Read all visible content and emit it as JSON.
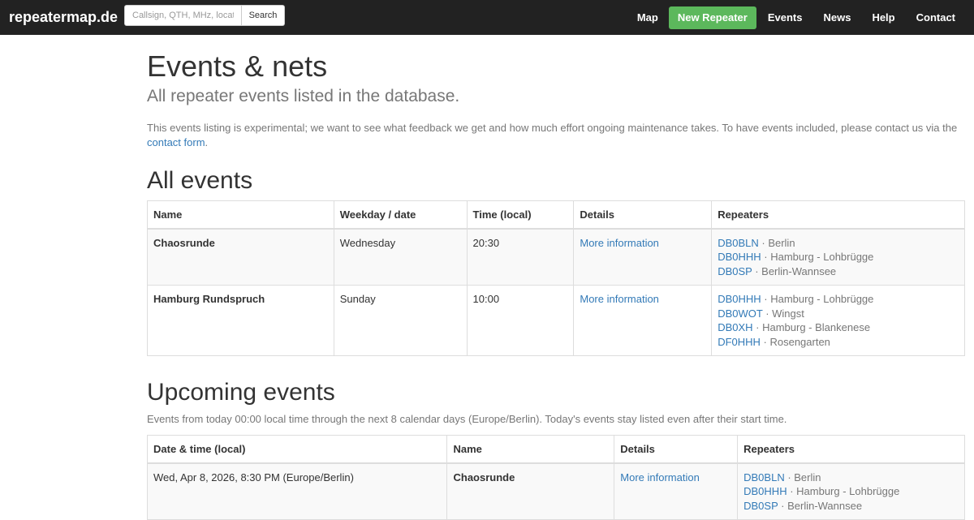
{
  "navbar": {
    "brand": "repeatermap.de",
    "search_placeholder": "Callsign, QTH, MHz, locator",
    "search_button": "Search",
    "links": {
      "map": "Map",
      "new_repeater": "New Repeater",
      "events": "Events",
      "news": "News",
      "help": "Help",
      "contact": "Contact"
    },
    "colors": {
      "bar": "#222222",
      "new_repeater_green": "#5cb85c"
    }
  },
  "page": {
    "title": "Events & nets",
    "lead": "All repeater events listed in the database.",
    "intro_text": "This events listing is experimental; we want to see what feedback we get and how much effort ongoing maintenance takes. To have events included, please contact us via the ",
    "intro_link": "contact form",
    "intro_end": "."
  },
  "all_events": {
    "heading": "All events",
    "columns": [
      "Name",
      "Weekday / date",
      "Time (local)",
      "Details",
      "Repeaters"
    ],
    "rows": [
      {
        "name": "Chaosrunde",
        "weekday": "Wednesday",
        "time": "20:30",
        "details": "More information",
        "repeaters": [
          {
            "call": "DB0BLN",
            "qth": " · Berlin"
          },
          {
            "call": "DB0HHH",
            "qth": " · Hamburg - Lohbrügge"
          },
          {
            "call": "DB0SP",
            "qth": " · Berlin-Wannsee"
          }
        ]
      },
      {
        "name": "Hamburg Rundspruch",
        "weekday": "Sunday",
        "time": "10:00",
        "details": "More information",
        "repeaters": [
          {
            "call": "DB0HHH",
            "qth": " · Hamburg - Lohbrügge"
          },
          {
            "call": "DB0WOT",
            "qth": " · Wingst"
          },
          {
            "call": "DB0XH",
            "qth": " · Hamburg - Blankenese"
          },
          {
            "call": "DF0HHH",
            "qth": " · Rosengarten"
          }
        ]
      }
    ]
  },
  "upcoming": {
    "heading": "Upcoming events",
    "subtext": "Events from today 00:00 local time through the next 8 calendar days (Europe/Berlin). Today's events stay listed even after their start time.",
    "columns": [
      "Date & time (local)",
      "Name",
      "Details",
      "Repeaters"
    ],
    "rows": [
      {
        "datetime": "Wed, Apr 8, 2026, 8:30 PM (Europe/Berlin)",
        "name": "Chaosrunde",
        "details": "More information",
        "repeaters": [
          {
            "call": "DB0BLN",
            "qth": " · Berlin"
          },
          {
            "call": "DB0HHH",
            "qth": " · Hamburg - Lohbrügge"
          },
          {
            "call": "DB0SP",
            "qth": " · Berlin-Wannsee"
          }
        ]
      }
    ]
  }
}
